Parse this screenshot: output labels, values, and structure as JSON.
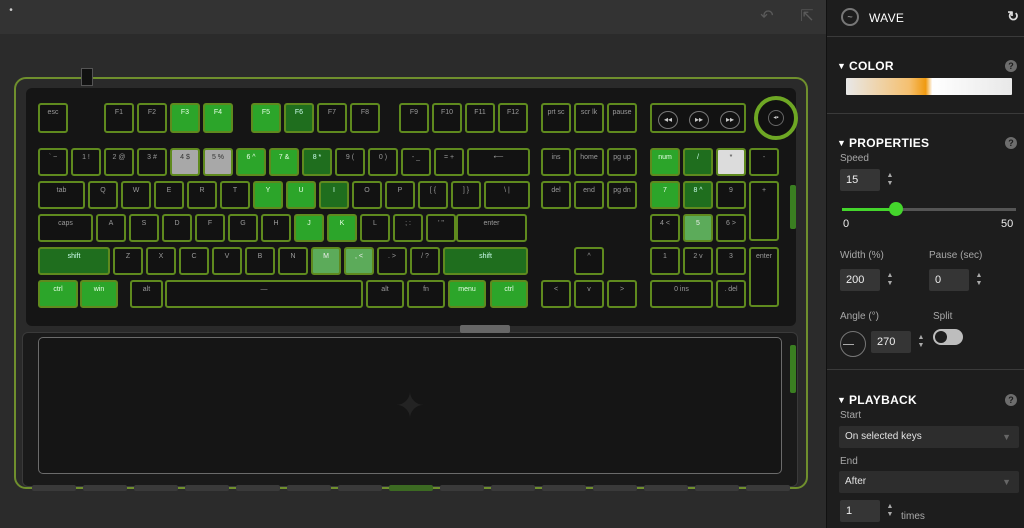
{
  "toolbar": {
    "undo_icon": "undo-icon",
    "export_icon": "export-icon"
  },
  "panel": {
    "effect_title": "WAVE",
    "color": {
      "title": "COLOR",
      "gradient": [
        "#e8e8e8",
        "#f5c070",
        "#f09a10",
        "#ffffff",
        "#e8e8e8"
      ]
    },
    "properties": {
      "title": "PROPERTIES",
      "speed_label": "Speed",
      "speed_value": "15",
      "speed_min": "0",
      "speed_max": "50",
      "speed_fraction": 0.31,
      "width_label": "Width (%)",
      "width_value": "200",
      "pause_label": "Pause (sec)",
      "pause_value": "0",
      "angle_label": "Angle (°)",
      "angle_value": "270",
      "split_label": "Split",
      "split_on": false
    },
    "playback": {
      "title": "PLAYBACK",
      "start_label": "Start",
      "start_value": "On selected keys",
      "end_label": "End",
      "end_value": "After",
      "times_value": "1",
      "times_unit": "times"
    }
  },
  "keyboard": {
    "accent_color": "#6ea724",
    "fn_row": [
      "esc",
      "F1",
      "F2",
      "F3",
      "F4",
      "F5",
      "F6",
      "F7",
      "F8",
      "F9",
      "F10",
      "F11",
      "F12",
      "prt sc",
      "scr lk",
      "pause"
    ],
    "media_icons": [
      "rewind-icon",
      "play-pause-icon",
      "fast-forward-icon"
    ],
    "row1": [
      "` ~",
      "1 !",
      "2 @",
      "3 #",
      "4 $",
      "5 %",
      "6 ^",
      "7 &",
      "8 *",
      "9 (",
      "0 )",
      "- _",
      "= +",
      "⟵",
      "ins",
      "home",
      "pg up",
      "num",
      "/",
      "*",
      "-"
    ],
    "row2": [
      "tab",
      "Q",
      "W",
      "E",
      "R",
      "T",
      "Y",
      "U",
      "I",
      "O",
      "P",
      "[ {",
      "] }",
      "\\ |",
      "del",
      "end",
      "pg dn",
      "7",
      "8 ^",
      "9",
      "+"
    ],
    "row3": [
      "caps",
      "A",
      "S",
      "D",
      "F",
      "G",
      "H",
      "J",
      "K",
      "L",
      "; :",
      "' \"",
      "enter",
      "4 <",
      "5",
      "6 >"
    ],
    "row4": [
      "shift",
      "Z",
      "X",
      "C",
      "V",
      "B",
      "N",
      "M",
      ", <",
      ". >",
      "/ ?",
      "shift",
      "^",
      "1",
      "2 v",
      "3",
      "enter"
    ],
    "row5": [
      "ctrl",
      "win",
      "alt",
      "—",
      "alt",
      "fn",
      "menu",
      "ctrl",
      "<",
      "v",
      ">",
      "0 ins",
      ". del"
    ]
  }
}
